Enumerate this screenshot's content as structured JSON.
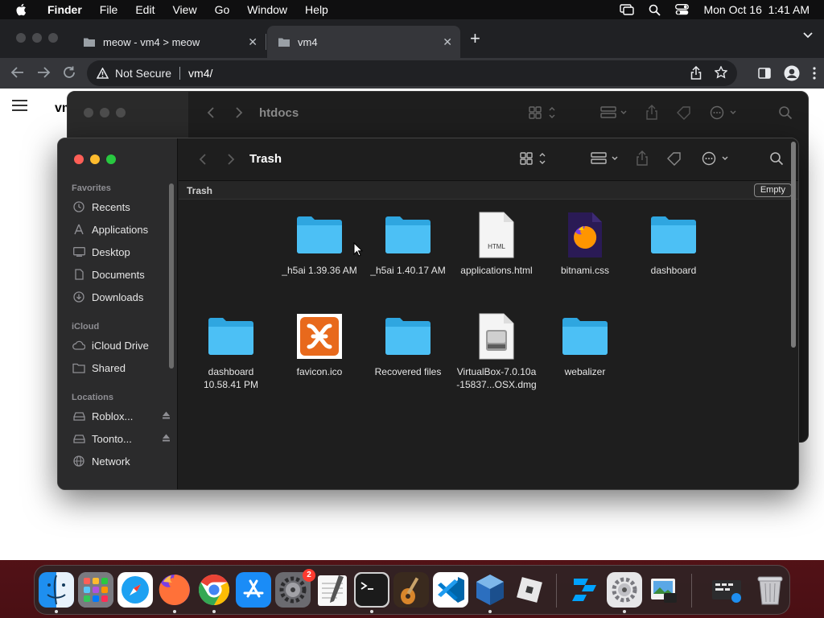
{
  "menubar": {
    "app_name": "Finder",
    "menus": [
      "File",
      "Edit",
      "View",
      "Go",
      "Window",
      "Help"
    ],
    "datetime": "Mon Oct 16  1:41 AM"
  },
  "chrome": {
    "tabs": [
      {
        "title": "meow - vm4 > meow"
      },
      {
        "title": "vm4"
      }
    ],
    "omnibox": {
      "security": "Not Secure",
      "url": "vm4/"
    },
    "page_title": "vm"
  },
  "finder_back": {
    "title": "htdocs"
  },
  "finder": {
    "title": "Trash",
    "path_label": "Trash",
    "empty_label": "Empty",
    "sidebar": {
      "favorites_header": "Favorites",
      "favorites": [
        {
          "label": "Recents",
          "icon": "clock-icon"
        },
        {
          "label": "Applications",
          "icon": "applications-icon"
        },
        {
          "label": "Desktop",
          "icon": "desktop-icon"
        },
        {
          "label": "Documents",
          "icon": "document-icon"
        },
        {
          "label": "Downloads",
          "icon": "download-icon"
        }
      ],
      "icloud_header": "iCloud",
      "icloud": [
        {
          "label": "iCloud Drive",
          "icon": "cloud-icon"
        },
        {
          "label": "Shared",
          "icon": "shared-folder-icon"
        }
      ],
      "locations_header": "Locations",
      "locations": [
        {
          "label": "Roblox...",
          "icon": "disk-icon"
        },
        {
          "label": "Toonto...",
          "icon": "disk-icon"
        },
        {
          "label": "Network",
          "icon": "network-icon"
        }
      ]
    },
    "items": [
      {
        "label": "_h5ai 1.39.36 AM",
        "icon": "folder-icon"
      },
      {
        "label": "_h5ai 1.40.17 AM",
        "icon": "folder-icon"
      },
      {
        "label": "applications.html",
        "icon": "html-file-icon",
        "badge": "HTML"
      },
      {
        "label": "bitnami.css",
        "icon": "firefox-document-icon"
      },
      {
        "label": "dashboard",
        "icon": "folder-icon"
      },
      {
        "label": "dashboard\n10.58.41 PM",
        "icon": "folder-icon"
      },
      {
        "label": "favicon.ico",
        "icon": "xampp-icon"
      },
      {
        "label": "Recovered files",
        "icon": "folder-icon"
      },
      {
        "label": "VirtualBox-7.0.10a\n-15837...OSX.dmg",
        "icon": "disk-image-icon"
      },
      {
        "label": "webalizer",
        "icon": "folder-icon"
      }
    ]
  },
  "dock": {
    "apps": [
      {
        "name": "finder-icon"
      },
      {
        "name": "launchpad-icon"
      },
      {
        "name": "safari-icon"
      },
      {
        "name": "firefox-icon"
      },
      {
        "name": "chrome-icon"
      },
      {
        "name": "app-store-icon"
      },
      {
        "name": "system-settings-icon",
        "badge": "2"
      },
      {
        "name": "textedit-icon"
      },
      {
        "name": "terminal-icon"
      },
      {
        "name": "garageband-icon"
      },
      {
        "name": "vscode-icon"
      },
      {
        "name": "virtualbox-icon"
      },
      {
        "name": "roblox-icon"
      },
      {
        "name": "roblox-studio-icon"
      },
      {
        "name": "settings-gear-icon"
      },
      {
        "name": "preview-icon"
      },
      {
        "name": "downloads-stack-icon"
      },
      {
        "name": "trash-icon"
      }
    ]
  }
}
